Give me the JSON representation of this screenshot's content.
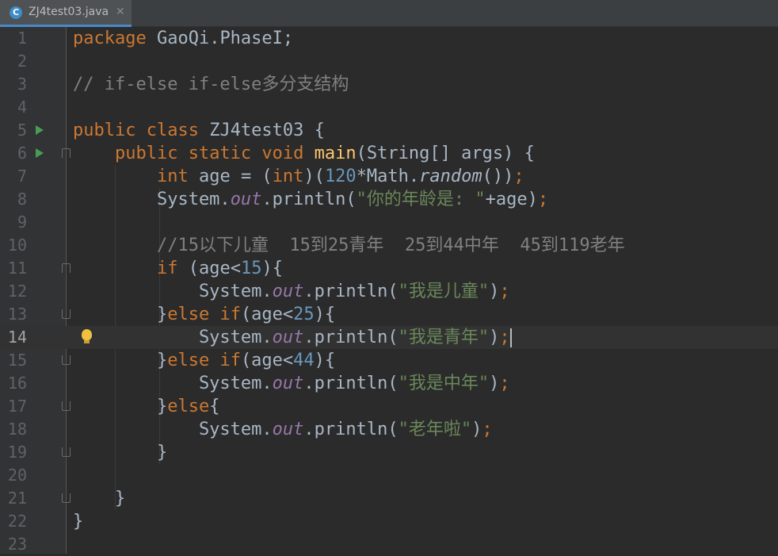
{
  "tab": {
    "filename": "ZJ4test03.java",
    "icon": "java-class-icon"
  },
  "lines": [
    {
      "num": "1"
    },
    {
      "num": "2"
    },
    {
      "num": "3"
    },
    {
      "num": "4"
    },
    {
      "num": "5"
    },
    {
      "num": "6"
    },
    {
      "num": "7"
    },
    {
      "num": "8"
    },
    {
      "num": "9"
    },
    {
      "num": "10"
    },
    {
      "num": "11"
    },
    {
      "num": "12"
    },
    {
      "num": "13"
    },
    {
      "num": "14"
    },
    {
      "num": "15"
    },
    {
      "num": "16"
    },
    {
      "num": "17"
    },
    {
      "num": "18"
    },
    {
      "num": "19"
    },
    {
      "num": "20"
    },
    {
      "num": "21"
    },
    {
      "num": "22"
    },
    {
      "num": "23"
    }
  ],
  "code": {
    "package_name": "GaoQi.PhaseI",
    "comment1": "// if-else if-else多分支结构",
    "class_name": "ZJ4test03",
    "method_name": "main",
    "params": "(String[] args) {",
    "random_const": "120",
    "age_prompt": "\"你的年龄是: \"",
    "comment2": "//15以下儿童  15到25青年  25到44中年  45到119老年",
    "lim1": "15",
    "lim2": "25",
    "lim3": "44",
    "msg1": "\"我是儿童\"",
    "msg2": "\"我是青年\"",
    "msg3": "\"我是中年\"",
    "msg4": "\"老年啦\""
  },
  "current_line": "14",
  "colors": {
    "keyword": "#cc7832",
    "string": "#6a8759",
    "number": "#6897bb",
    "comment": "#808080",
    "method": "#ffc66d",
    "field": "#9876aa",
    "text": "#a9b7c6"
  }
}
